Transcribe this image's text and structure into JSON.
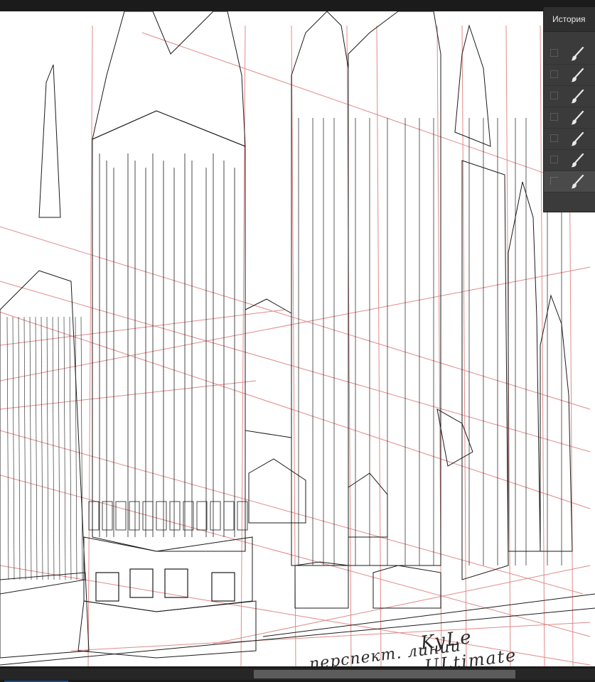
{
  "history_panel": {
    "title": "История",
    "items": [
      {
        "icon": "brush-icon",
        "active": false
      },
      {
        "icon": "brush-icon",
        "active": false
      },
      {
        "icon": "brush-icon",
        "active": false
      },
      {
        "icon": "brush-icon",
        "active": false
      },
      {
        "icon": "brush-icon",
        "active": false
      },
      {
        "icon": "brush-icon",
        "active": false
      },
      {
        "icon": "brush-icon",
        "active": true
      }
    ]
  },
  "canvas": {
    "handwriting_line1": "...перспект. линии",
    "handwriting_line2": "KyLe",
    "handwriting_line3": "ULtimate"
  },
  "colors": {
    "panel_bg": "#3b3b3b",
    "panel_header": "#2f2f2f",
    "perspective_lines": "#e08a8a",
    "ink": "#1a1a1a"
  }
}
